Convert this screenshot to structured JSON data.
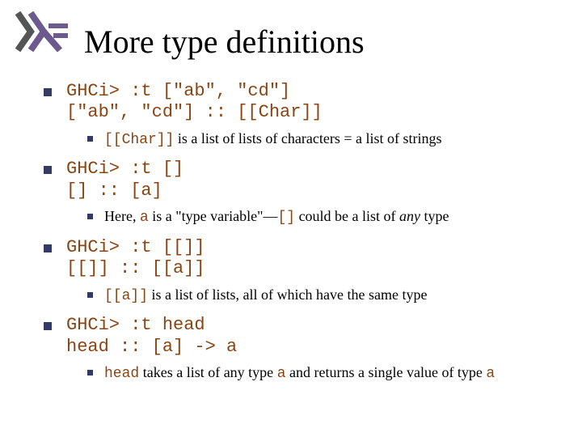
{
  "title": "More type definitions",
  "blocks": [
    {
      "code_line1": "GHCi> :t [\"ab\", \"cd\"]",
      "code_line2": "[\"ab\", \"cd\"] :: [[Char]]",
      "sub_code1": "[[Char]]",
      "sub_text1": " is a list of lists of characters = a list of strings"
    },
    {
      "code_line1": "GHCi> :t []",
      "code_line2": "[] :: [a]",
      "sub_pre": "Here, ",
      "sub_code_a": "a",
      "sub_mid": " is a \"type variable\"—",
      "sub_code_b": "[]",
      "sub_post1": " could be a list of ",
      "sub_em": "any",
      "sub_post2": " type"
    },
    {
      "code_line1": "GHCi> :t [[]]",
      "code_line2": "[[]] :: [[a]]",
      "sub_code1": "[[a]]",
      "sub_text1": " is a list of lists, all of which have the same type"
    },
    {
      "code_line1": "GHCi> :t head",
      "code_line2": "head :: [a] -> a",
      "sub_code_a": "head",
      "sub_mid": " takes a list of any type ",
      "sub_code_b": "a",
      "sub_post1": " and returns a single value of type ",
      "sub_code_c": "a"
    }
  ]
}
